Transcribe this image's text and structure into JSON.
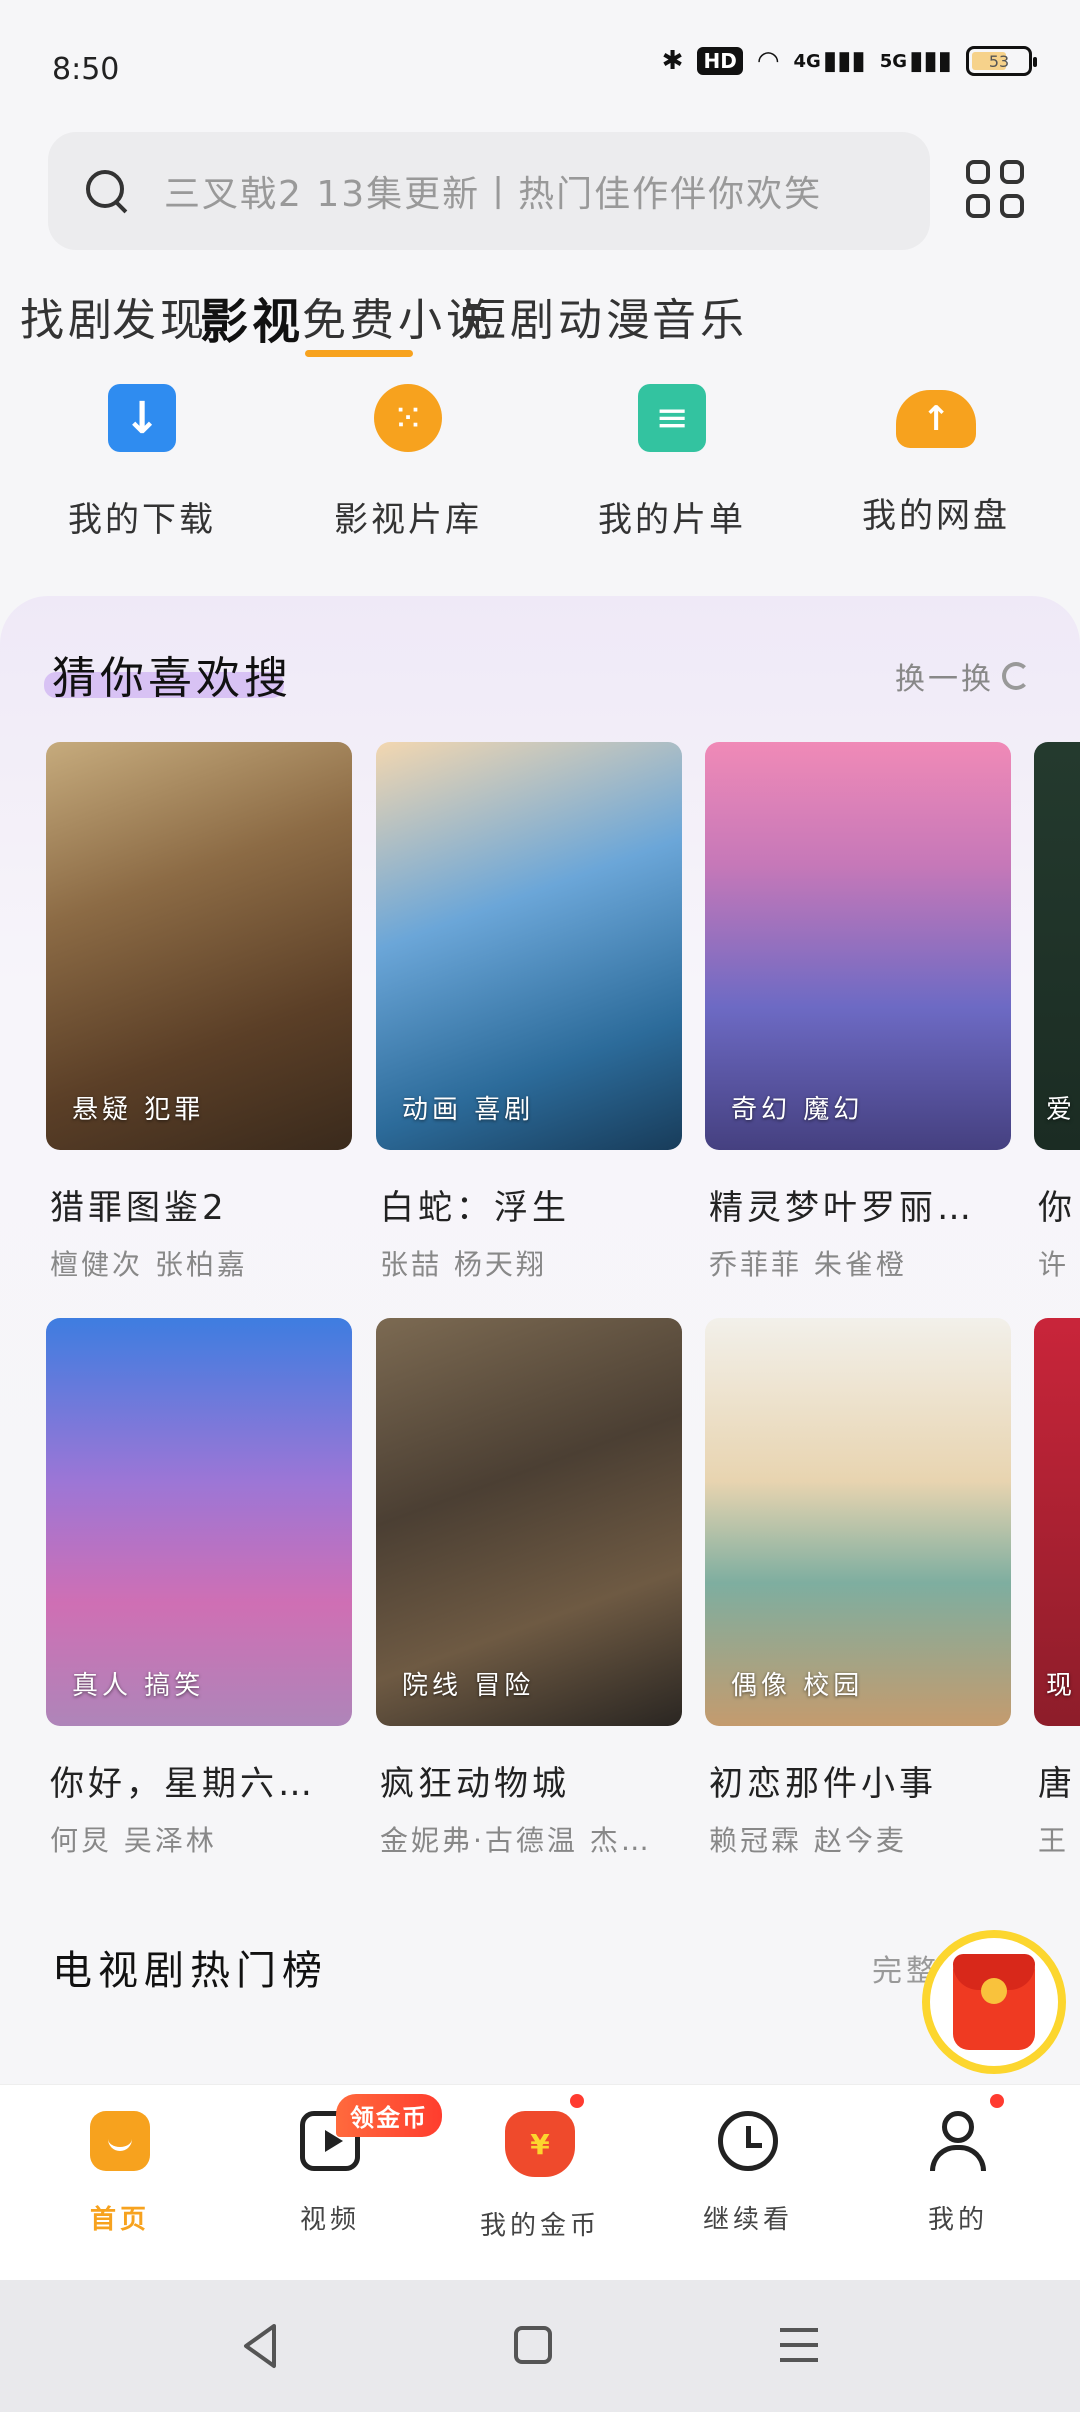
{
  "status_bar": {
    "time": "8:50",
    "hd_label": "HD",
    "net_4g": "4G",
    "net_5g": "5G",
    "battery": "53"
  },
  "search": {
    "placeholder": "三叉戟2 13集更新丨热门佳作伴你欢笑"
  },
  "tabs": [
    "找剧",
    "发现",
    "影视",
    "免费小说",
    "短剧",
    "动漫",
    "音乐"
  ],
  "active_tab": "影视",
  "quick_entries": [
    {
      "label": "我的下载",
      "icon": "download-icon"
    },
    {
      "label": "影视片库",
      "icon": "film-library-icon"
    },
    {
      "label": "我的片单",
      "icon": "playlist-icon"
    },
    {
      "label": "我的网盘",
      "icon": "cloud-drive-icon"
    }
  ],
  "recommend": {
    "title": "猜你喜欢搜",
    "refresh_label": "换一换",
    "items": [
      {
        "title": "猎罪图鉴2",
        "cast": "檀健次 张柏嘉",
        "tag": "悬疑 犯罪"
      },
      {
        "title": "白蛇：浮生",
        "cast": "张喆 杨天翔",
        "tag": "动画 喜剧"
      },
      {
        "title": "精灵梦叶罗丽…",
        "cast": "乔菲菲 朱雀橙",
        "tag": "奇幻 魔幻"
      },
      {
        "title": "你",
        "cast": "许",
        "tag": "爱"
      },
      {
        "title": "你好，星期六…",
        "cast": "何炅 吴泽林",
        "tag": "真人 搞笑"
      },
      {
        "title": "疯狂动物城",
        "cast": "金妮弗·古德温 杰…",
        "tag": "院线 冒险"
      },
      {
        "title": "初恋那件小事",
        "cast": "赖冠霖 赵今麦",
        "tag": "偶像 校园"
      },
      {
        "title": "唐",
        "cast": "王",
        "tag": "现"
      }
    ]
  },
  "hot_chart": {
    "title": "电视剧热门榜",
    "more_label": "完整榜单"
  },
  "bottom_nav": {
    "items": [
      {
        "label": "首页",
        "icon": "home-icon"
      },
      {
        "label": "视频",
        "icon": "video-icon"
      },
      {
        "label": "我的金币",
        "icon": "coin-bag-icon"
      },
      {
        "label": "继续看",
        "icon": "history-clock-icon"
      },
      {
        "label": "我的",
        "icon": "user-icon"
      }
    ],
    "active": "首页",
    "video_badge": "领金币"
  },
  "colors": {
    "accent": "#f7a21e",
    "badge": "#ff3d2e"
  }
}
